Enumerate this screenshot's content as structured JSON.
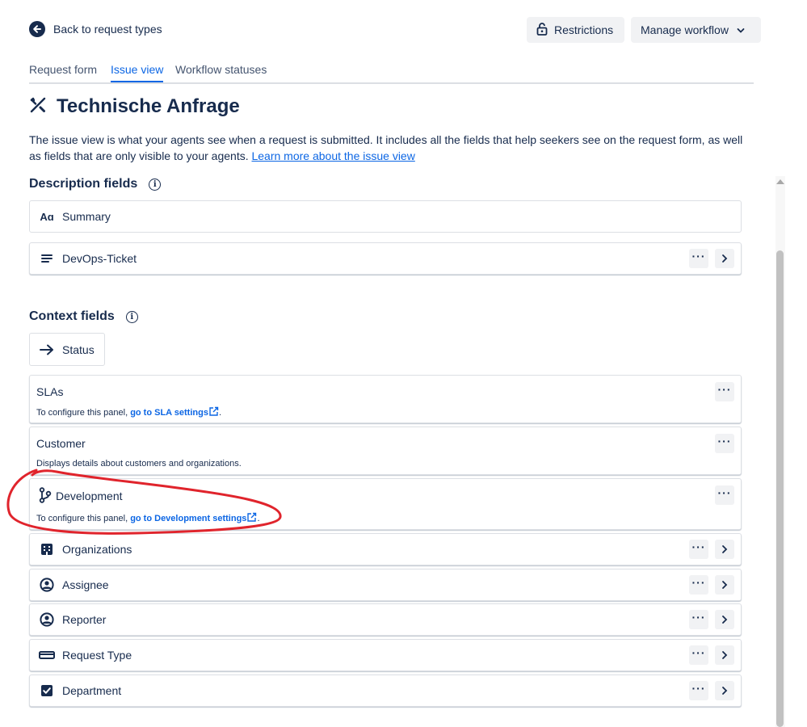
{
  "header": {
    "back_label": "Back to request types",
    "restrictions_label": "Restrictions",
    "manage_workflow_label": "Manage workflow"
  },
  "tabs": [
    {
      "label": "Request form",
      "active": false
    },
    {
      "label": "Issue view",
      "active": true
    },
    {
      "label": "Workflow statuses",
      "active": false
    }
  ],
  "page": {
    "title": "Technische Anfrage",
    "title_icon": "tools-icon",
    "description": "The issue view is what your agents see when a request is submitted. It includes all the fields that help seekers see on the request form, as well as fields that are only visible to your agents. ",
    "description_link": "Learn more about the issue view"
  },
  "description_fields": {
    "heading": "Description fields",
    "items": [
      {
        "label": "Summary",
        "icon": "text-format-icon"
      },
      {
        "label": "DevOps-Ticket",
        "icon": "paragraph-icon"
      }
    ]
  },
  "context_fields": {
    "heading": "Context fields",
    "status": {
      "label": "Status",
      "icon": "arrow-right-icon"
    },
    "panels": [
      {
        "title": "SLAs",
        "sub_prefix": "To configure this panel, ",
        "sub_link": "go to SLA settings",
        "sub_suffix": "."
      },
      {
        "title": "Customer",
        "sub_prefix": "Displays details about customers and organizations.",
        "sub_link": "",
        "sub_suffix": ""
      },
      {
        "title": "Development",
        "sub_prefix": "To configure this panel, ",
        "sub_link": "go to Development settings",
        "sub_suffix": "."
      }
    ],
    "items": [
      {
        "label": "Organizations",
        "icon": "office-building-icon"
      },
      {
        "label": "Assignee",
        "icon": "person-circle-icon"
      },
      {
        "label": "Reporter",
        "icon": "person-circle-icon"
      },
      {
        "label": "Request Type",
        "icon": "rectangle-icon"
      },
      {
        "label": "Department",
        "icon": "checkbox-icon"
      }
    ]
  },
  "colors": {
    "link": "#0c66e4",
    "text": "#172b4d",
    "annotation": "#e0242c"
  }
}
